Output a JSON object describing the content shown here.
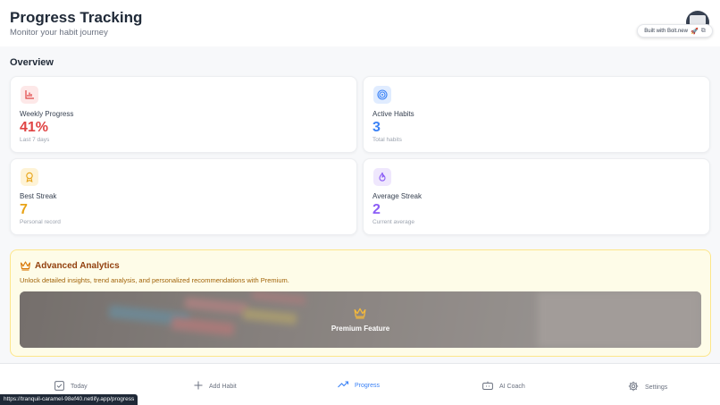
{
  "header": {
    "title": "Progress Tracking",
    "subtitle": "Monitor your habit journey",
    "badge_label": "Built with Bolt.new"
  },
  "overview_label": "Overview",
  "stats": [
    {
      "icon": "bar-chart-icon",
      "label": "Weekly Progress",
      "value": "41%",
      "sub": "Last 7 days",
      "color": "#e04444",
      "icon_bg": "#fde8e8"
    },
    {
      "icon": "target-icon",
      "label": "Active Habits",
      "value": "3",
      "sub": "Total habits",
      "color": "#3b82f6",
      "icon_bg": "#e0ecff"
    },
    {
      "icon": "award-icon",
      "label": "Best Streak",
      "value": "7",
      "sub": "Personal record",
      "color": "#e8a317",
      "icon_bg": "#fef3d6"
    },
    {
      "icon": "flame-icon",
      "label": "Average Streak",
      "value": "2",
      "sub": "Current average",
      "color": "#8b5cf6",
      "icon_bg": "#efe7fd"
    }
  ],
  "premium": {
    "title": "Advanced Analytics",
    "description": "Unlock detailed insights, trend analysis, and personalized recommendations with Premium.",
    "feature_label": "Premium Feature",
    "icon": "crown-icon"
  },
  "nav": [
    {
      "label": "Today",
      "icon": "checkbox-icon",
      "active": false
    },
    {
      "label": "Add Habit",
      "icon": "plus-icon",
      "active": false
    },
    {
      "label": "Progress",
      "icon": "trend-up-icon",
      "active": true
    },
    {
      "label": "AI Coach",
      "icon": "bot-icon",
      "active": false
    },
    {
      "label": "Settings",
      "icon": "gear-icon",
      "active": false
    }
  ],
  "status_url": "https://tranquil-caramel-98ef40.netlify.app/progress",
  "colors": {
    "accent": "#3b82f6",
    "premium_text": "#92400e",
    "premium_bg": "#fefce8"
  }
}
